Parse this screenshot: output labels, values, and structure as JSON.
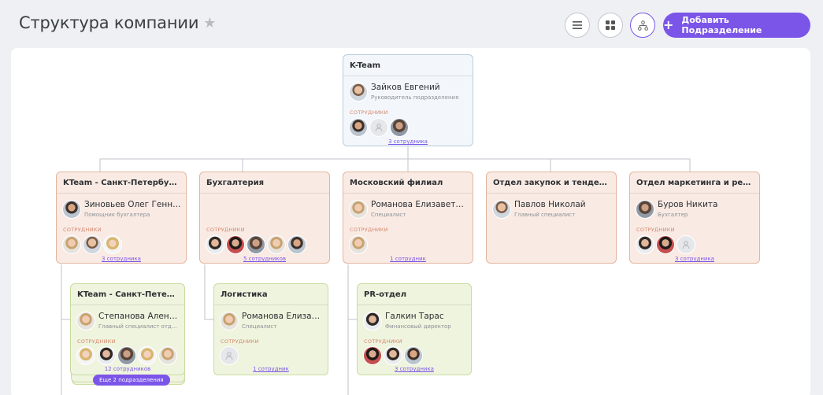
{
  "page": {
    "title": "Структура компании"
  },
  "toolbar": {
    "add_label": "Добавить Подразделение"
  },
  "labels": {
    "employees": "СОТРУДНИКИ"
  },
  "colors": {
    "accent": "#7b55e8",
    "root_card": "#f3f7fb",
    "level1_card": "#f9ebe4",
    "level2_card": "#eff4de"
  },
  "root": {
    "title": "K-Team",
    "head_name": "Зайков Евгений",
    "head_role": "Руководитель подразделения",
    "count": "3 сотрудника"
  },
  "departments": [
    {
      "title": "KTeam - Санкт-Петербургск...",
      "head_name": "Зиновьев Олег Генна...",
      "head_role": "Помощник бухгалтера",
      "count": "3 сотрудника"
    },
    {
      "title": "Бухгалтерия",
      "count": "5 сотрудников"
    },
    {
      "title": "Московский филиал",
      "head_name": "Романова Елизавета ...",
      "head_role": "Специалист",
      "count": "1 сотрудник"
    },
    {
      "title": "Отдел закупок и тендеров",
      "head_name": "Павлов Николай",
      "head_role": "Главный специалист"
    },
    {
      "title": "Отдел маркетинга и рекламы",
      "head_name": "Буров Никита",
      "head_role": "Бухгалтер",
      "count": "3 сотрудника"
    }
  ],
  "subdepartments": [
    {
      "title": "KTeam - Санкт-Петербу...",
      "head_name": "Степанова Алена ...",
      "head_role": "Главный специалист отдела ...",
      "count": "12 сотрудников",
      "more": "Еще 2 подразделения"
    },
    {
      "title": "Логистика",
      "head_name": "Романова Елизав...",
      "head_role": "Специалист",
      "count": "1 сотрудник"
    },
    {
      "title": "PR-отдел",
      "head_name": "Галкин Тарас",
      "head_role": "Финансовый директор",
      "count": "3 сотрудника"
    }
  ]
}
